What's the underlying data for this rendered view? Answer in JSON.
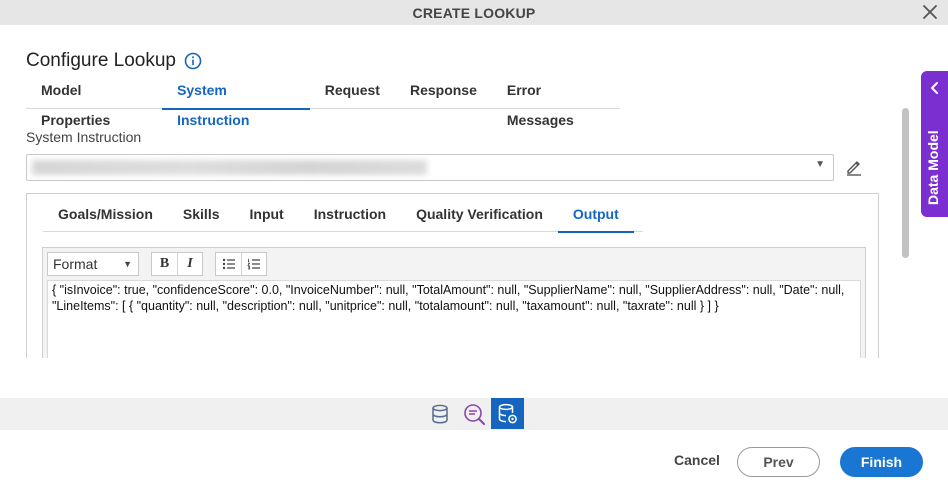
{
  "window": {
    "title": "CREATE LOOKUP"
  },
  "heading": {
    "title": "Configure Lookup"
  },
  "tabs": [
    {
      "label": "Model Properties"
    },
    {
      "label": "System Instruction"
    },
    {
      "label": "Request"
    },
    {
      "label": "Response"
    },
    {
      "label": "Error Messages"
    }
  ],
  "active_tab": "System Instruction",
  "system_instruction": {
    "label": "System Instruction",
    "selected_value_obscured": true
  },
  "subtabs": [
    {
      "label": "Goals/Mission"
    },
    {
      "label": "Skills"
    },
    {
      "label": "Input"
    },
    {
      "label": "Instruction"
    },
    {
      "label": "Quality Verification"
    },
    {
      "label": "Output"
    }
  ],
  "active_subtab": "Output",
  "editor": {
    "format_label": "Format",
    "bold_label": "B",
    "italic_label": "I",
    "content": "{ \"isInvoice\": true, \"confidenceScore\": 0.0, \"InvoiceNumber\": null, \"TotalAmount\": null, \"SupplierName\": null, \"SupplierAddress\": null, \"Date\": null, \"LineItems\": [ { \"quantity\": null, \"description\": null, \"unitprice\": null, \"totalamount\": null, \"taxamount\": null, \"taxrate\": null } ] }"
  },
  "side_panel": {
    "label": "Data Model"
  },
  "footer": {
    "cancel_label": "Cancel",
    "prev_label": "Prev",
    "finish_label": "Finish"
  },
  "icons": {
    "close": "close-icon",
    "info": "info-icon",
    "edit": "pencil-icon",
    "steps": [
      "database-icon",
      "search-list-icon",
      "database-settings-icon"
    ]
  },
  "colors": {
    "accent": "#1565c0",
    "finish_button": "#1976d2",
    "data_model_tab": "#7b2fd0",
    "title_bar": "#e6e6e6"
  }
}
